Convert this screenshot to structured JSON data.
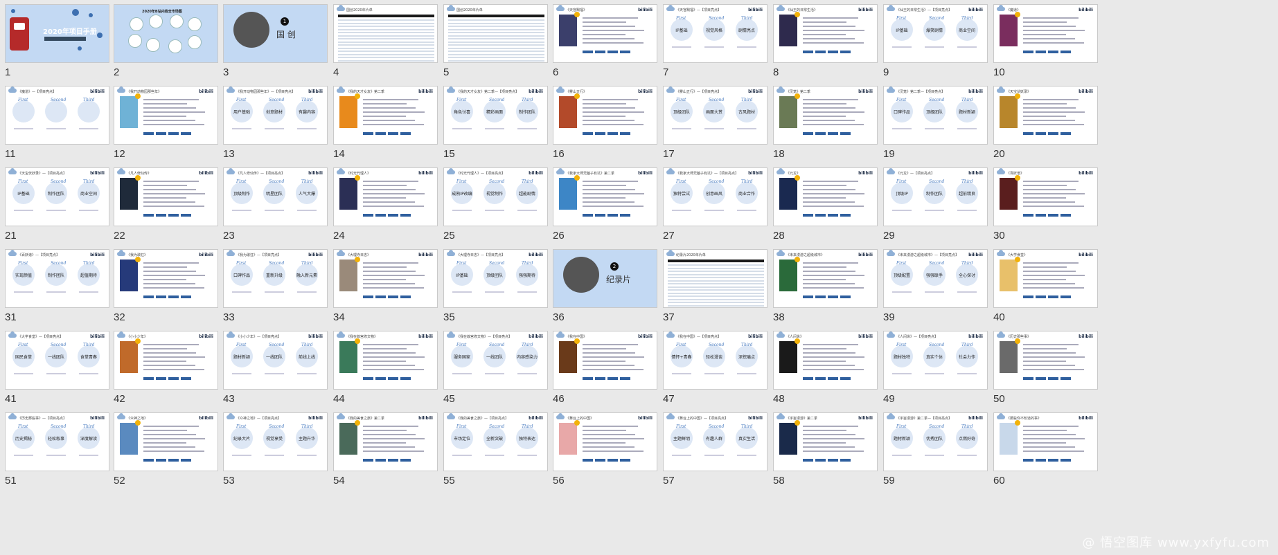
{
  "slides": [
    {
      "n": "1",
      "kind": "cover",
      "title": "2020年项目手册"
    },
    {
      "n": "2",
      "kind": "map",
      "title": "2020年B站内容全市场图"
    },
    {
      "n": "3",
      "kind": "section",
      "title": "国 创",
      "badge": "1"
    },
    {
      "n": "4",
      "kind": "table",
      "header": "国创2020年片单"
    },
    {
      "n": "5",
      "kind": "table",
      "header": "国创2020年片单"
    },
    {
      "n": "6",
      "kind": "poster",
      "header": "《天官赐福》",
      "color": "#3b3f6b"
    },
    {
      "n": "7",
      "kind": "three",
      "header": "《天官赐福》—【项目亮点】",
      "labels": [
        "IP基础",
        "视觉风格",
        "剧情亮点"
      ]
    },
    {
      "n": "8",
      "kind": "poster",
      "header": "《仙王的日常生活》",
      "color": "#2e2a4d"
    },
    {
      "n": "9",
      "kind": "three",
      "header": "《仙王的日常生活》—【项目亮点】",
      "labels": [
        "IP基础",
        "爆笑剧情",
        "商业空间"
      ]
    },
    {
      "n": "10",
      "kind": "poster",
      "header": "《魔道》",
      "color": "#7a2d5e"
    },
    {
      "n": "11",
      "kind": "three",
      "header": "《魔道》—【项目亮点】",
      "labels": [
        "",
        "",
        ""
      ]
    },
    {
      "n": "12",
      "kind": "poster",
      "header": "《我开动物园那些年》",
      "color": "#6fb2d6"
    },
    {
      "n": "13",
      "kind": "three",
      "header": "《我开动物园那些年》—【项目亮点】",
      "labels": [
        "用户基础",
        "创意题材",
        "有趣内容"
      ]
    },
    {
      "n": "14",
      "kind": "poster",
      "header": "《我的天才女友》第二季",
      "color": "#e88a1c"
    },
    {
      "n": "15",
      "kind": "three",
      "header": "《我的天才女友》第二季—【项目亮点】",
      "labels": [
        "角色讨喜",
        "精彩画面",
        "制作团队"
      ]
    },
    {
      "n": "16",
      "kind": "poster",
      "header": "《雾山五行》",
      "color": "#b34a2a"
    },
    {
      "n": "17",
      "kind": "three",
      "header": "《雾山五行》—【项目亮点】",
      "labels": [
        "顶级团队",
        "画面大赏",
        "古风题材"
      ]
    },
    {
      "n": "18",
      "kind": "poster",
      "header": "《灵笼》第二季",
      "color": "#6a7a55"
    },
    {
      "n": "19",
      "kind": "three",
      "header": "《灵笼》第二季—【项目亮点】",
      "labels": [
        "口碑作品",
        "顶级团队",
        "题材新颖"
      ]
    },
    {
      "n": "20",
      "kind": "poster",
      "header": "《天宝伏妖录》",
      "color": "#b8862b"
    },
    {
      "n": "21",
      "kind": "three",
      "header": "《天宝伏妖录》—【项目亮点】",
      "labels": [
        "IP基础",
        "制作团队",
        "商业空间"
      ]
    },
    {
      "n": "22",
      "kind": "poster",
      "header": "《凡人修仙传》",
      "color": "#1f2a3a"
    },
    {
      "n": "23",
      "kind": "three",
      "header": "《凡人修仙传》—【项目亮点】",
      "labels": [
        "顶级制作",
        "明星团队",
        "人气大爆"
      ]
    },
    {
      "n": "24",
      "kind": "poster",
      "header": "《时光代理人》",
      "color": "#2b2f55"
    },
    {
      "n": "25",
      "kind": "three",
      "header": "《时光代理人》—【项目亮点】",
      "labels": [
        "成熟IP改编",
        "视觉制作",
        "超能剧情"
      ]
    },
    {
      "n": "26",
      "kind": "poster",
      "header": "《我家大师兄脑子有坑》第二季",
      "color": "#3d86c6"
    },
    {
      "n": "27",
      "kind": "three",
      "header": "《我家大师兄脑子有坑》—【项目亮点】",
      "labels": [
        "独特尝试",
        "创意画风",
        "商业合作"
      ]
    },
    {
      "n": "28",
      "kind": "poster",
      "header": "《元龙》",
      "color": "#1a2950"
    },
    {
      "n": "29",
      "kind": "three",
      "header": "《元龙》—【项目亮点】",
      "labels": [
        "顶级IP",
        "制作团队",
        "超前精良"
      ]
    },
    {
      "n": "30",
      "kind": "poster",
      "header": "《百妖谱》",
      "color": "#5a1e1e"
    },
    {
      "n": "31",
      "kind": "three",
      "header": "《百妖谱》—【项目亮点】",
      "labels": [
        "实现颜值",
        "制作团队",
        "超值期待"
      ]
    },
    {
      "n": "32",
      "kind": "poster",
      "header": "《我为歌狂》",
      "color": "#263a7a"
    },
    {
      "n": "33",
      "kind": "three",
      "header": "《我为歌狂》—【项目亮点】",
      "labels": [
        "口碑作品",
        "重新升级",
        "融入新元素"
      ]
    },
    {
      "n": "34",
      "kind": "poster",
      "header": "《大理寺日志》",
      "color": "#9a8a7a"
    },
    {
      "n": "35",
      "kind": "three",
      "header": "《大理寺日志》—【项目亮点】",
      "labels": [
        "IP基础",
        "顶级团队",
        "强强期待"
      ]
    },
    {
      "n": "36",
      "kind": "section",
      "title": "纪录片",
      "badge": "2"
    },
    {
      "n": "37",
      "kind": "table",
      "header": "纪录片2020年片单"
    },
    {
      "n": "38",
      "kind": "poster",
      "header": "《未来漫游之超级城市》",
      "color": "#2a6a3a"
    },
    {
      "n": "39",
      "kind": "three",
      "header": "《未来漫游之超级城市》—【项目亮点】",
      "labels": [
        "顶级配置",
        "强强联手",
        "全心探讨"
      ]
    },
    {
      "n": "40",
      "kind": "poster",
      "header": "《大学食堂》",
      "color": "#e8c06a"
    },
    {
      "n": "41",
      "kind": "three",
      "header": "《大学食堂》—【项目亮点】",
      "labels": [
        "国民食堂",
        "一线团队",
        "食堂青春"
      ]
    },
    {
      "n": "42",
      "kind": "poster",
      "header": "《小小少年》",
      "color": "#c06a2a"
    },
    {
      "n": "43",
      "kind": "three",
      "header": "《小小少年》—【项目亮点】",
      "labels": [
        "题材新颖",
        "一线团队",
        "前线上线"
      ]
    },
    {
      "n": "44",
      "kind": "poster",
      "header": "《我在故宫修文物》",
      "color": "#3a7a5a"
    },
    {
      "n": "45",
      "kind": "three",
      "header": "《我在故宫修文物》—【项目亮点】",
      "labels": [
        "服务国家",
        "一线团队",
        "内容感染力"
      ]
    },
    {
      "n": "46",
      "kind": "poster",
      "header": "《我在中国》",
      "color": "#6a3a1a"
    },
    {
      "n": "47",
      "kind": "three",
      "header": "《我在中国》—【项目亮点】",
      "labels": [
        "情怀+青春",
        "轻松漫谈",
        "深挖痛点"
      ]
    },
    {
      "n": "48",
      "kind": "poster",
      "header": "《人间世》",
      "color": "#1a1a1a"
    },
    {
      "n": "49",
      "kind": "three",
      "header": "《人间世》—【项目亮点】",
      "labels": [
        "题材独特",
        "真实个体",
        "社会力作"
      ]
    },
    {
      "n": "50",
      "kind": "poster",
      "header": "《历史那些事》",
      "color": "#6a6a6a"
    },
    {
      "n": "51",
      "kind": "three",
      "header": "《历史那些事》—【项目亮点】",
      "labels": [
        "历史揭秘",
        "轻松叙事",
        "深度解读"
      ]
    },
    {
      "n": "52",
      "kind": "poster",
      "header": "《众神之地》",
      "color": "#5a8abf"
    },
    {
      "n": "53",
      "kind": "three",
      "header": "《众神之地》—【项目亮点】",
      "labels": [
        "纪录大片",
        "视觉享受",
        "主题升华"
      ]
    },
    {
      "n": "54",
      "kind": "poster",
      "header": "《我的美食之旅》第二季",
      "color": "#4a6a5a"
    },
    {
      "n": "55",
      "kind": "three",
      "header": "《我的美食之旅》—【项目亮点】",
      "labels": [
        "市场定位",
        "全新突破",
        "独特表达"
      ]
    },
    {
      "n": "56",
      "kind": "poster",
      "header": "《舞台上的中国》",
      "color": "#e8a8a8"
    },
    {
      "n": "57",
      "kind": "three",
      "header": "《舞台上的中国》—【项目亮点】",
      "labels": [
        "主题鲜明",
        "有趣人群",
        "真实生活"
      ]
    },
    {
      "n": "58",
      "kind": "poster",
      "header": "《宇宙漫游》第二季",
      "color": "#1a2a4a"
    },
    {
      "n": "59",
      "kind": "three",
      "header": "《宇宙漫游》第二季—【项目亮点】",
      "labels": [
        "题材新颖",
        "优秀团队",
        "点燃好奇"
      ]
    },
    {
      "n": "60",
      "kind": "poster",
      "header": "《那些你不知道的事》",
      "color": "#c8d8ea"
    }
  ],
  "three_tags": [
    "First",
    "Second",
    "Third"
  ],
  "brand": "bilibili",
  "watermark": "@ 悟空图库 www.yxfyfu.com"
}
